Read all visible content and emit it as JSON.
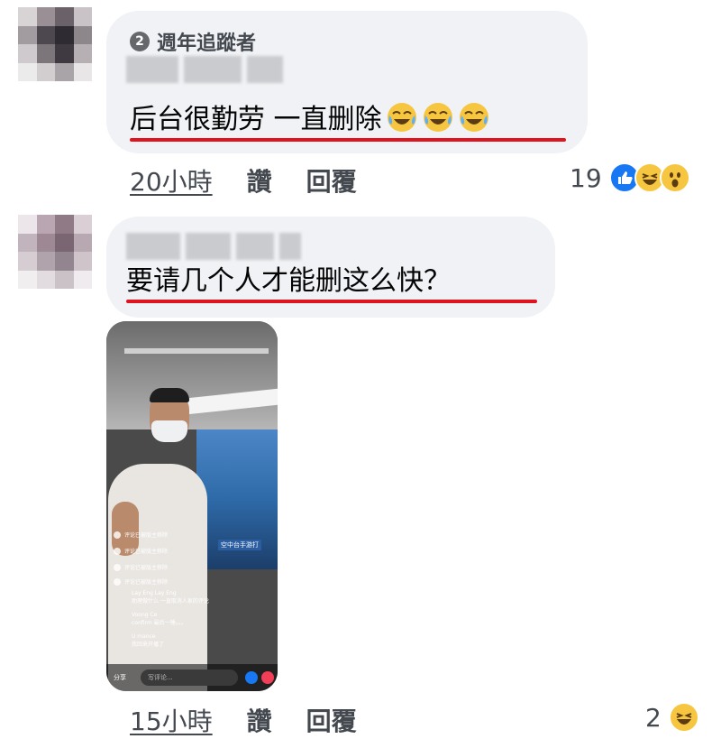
{
  "comments": [
    {
      "badge": "週年追蹤者",
      "badge_number": "2",
      "text": "后台很勤劳 一直删除",
      "emoji_count": 3,
      "time": "20小時",
      "like_label": "讚",
      "reply_label": "回覆",
      "reaction_count": "19",
      "reactions": [
        "like-icon",
        "laugh-icon",
        "wow-icon"
      ]
    },
    {
      "text": "要请几个人才能删这么快？",
      "time": "15小時",
      "like_label": "讚",
      "reply_label": "回覆",
      "reaction_count": "2",
      "reactions": [
        "laugh-icon"
      ]
    }
  ],
  "phone": {
    "screen_banner": "空中台手游打",
    "overlay_lines": [
      "评论已被版主移除",
      "评论已被版主移除",
      "评论已被版主移除",
      "评论已被版主移除"
    ],
    "commenters": [
      {
        "name": "Lay Eng Lay Eng",
        "text": "助理做什么 一直取消人家的评论"
      },
      {
        "name": "Voong Ce",
        "text": "confirm 最后一锤。。。"
      },
      {
        "name": "U mance",
        "text": "我回来开播了"
      }
    ],
    "share_label": "分享",
    "input_placeholder": "写评论..."
  },
  "colors": {
    "bubble": "#f0f2f5",
    "underline": "#e0141e",
    "like_blue": "#1877f2",
    "emoji_yellow": "#f7c640"
  }
}
